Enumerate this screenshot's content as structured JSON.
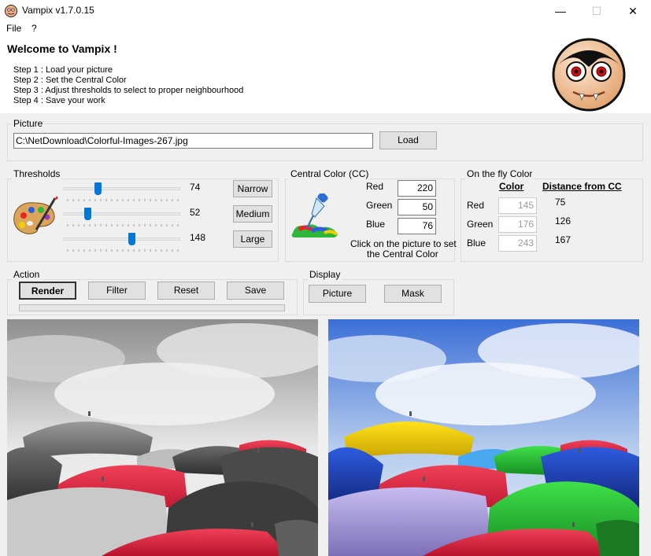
{
  "window": {
    "title": "Vampix v1.7.0.15",
    "minimize_glyph": "—",
    "maximize_glyph": "☐",
    "close_glyph": "✕"
  },
  "menu": {
    "file": "File",
    "help": "?"
  },
  "welcome": {
    "heading": "Welcome to Vampix !",
    "steps": [
      "Step 1 : Load your picture",
      "Step 2 : Set the Central Color",
      "Step 3 : Adjust thresholds to select to proper neighbourhood",
      "Step 4 : Save your work"
    ]
  },
  "picture": {
    "title": "Picture",
    "path": "C:\\NetDownload\\Colorful-Images-267.jpg",
    "load_label": "Load"
  },
  "thresholds": {
    "title": "Thresholds",
    "sliders": [
      {
        "value": "74",
        "level": 74
      },
      {
        "value": "52",
        "level": 52
      },
      {
        "value": "148",
        "level": 148
      }
    ],
    "narrow_label": "Narrow",
    "medium_label": "Medium",
    "large_label": "Large"
  },
  "central_color": {
    "title": "Central Color (CC)",
    "red_label": "Red",
    "red_value": "220",
    "green_label": "Green",
    "green_value": "50",
    "blue_label": "Blue",
    "blue_value": "76",
    "hint_line1": "Click on the picture to set",
    "hint_line2": "the Central Color"
  },
  "fly_color": {
    "title": "On the fly Color",
    "color_header": "Color",
    "distance_header": "Distance from CC",
    "red_label": "Red",
    "red_value": "145",
    "red_distance": "75",
    "green_label": "Green",
    "green_value": "176",
    "green_distance": "126",
    "blue_label": "Blue",
    "blue_value": "243",
    "blue_distance": "167"
  },
  "action": {
    "title": "Action",
    "render_label": "Render",
    "filter_label": "Filter",
    "reset_label": "Reset",
    "save_label": "Save"
  },
  "display": {
    "title": "Display",
    "picture_label": "Picture",
    "mask_label": "Mask"
  },
  "colors": {
    "accent": "#0078d7",
    "sky": "#5a82d8",
    "umbrella_red": "#e02a45",
    "umbrella_yellow": "#f2d200",
    "umbrella_green": "#2fc63a",
    "umbrella_blue": "#2a4fc8",
    "umbrella_purple": "#a89ad6"
  }
}
